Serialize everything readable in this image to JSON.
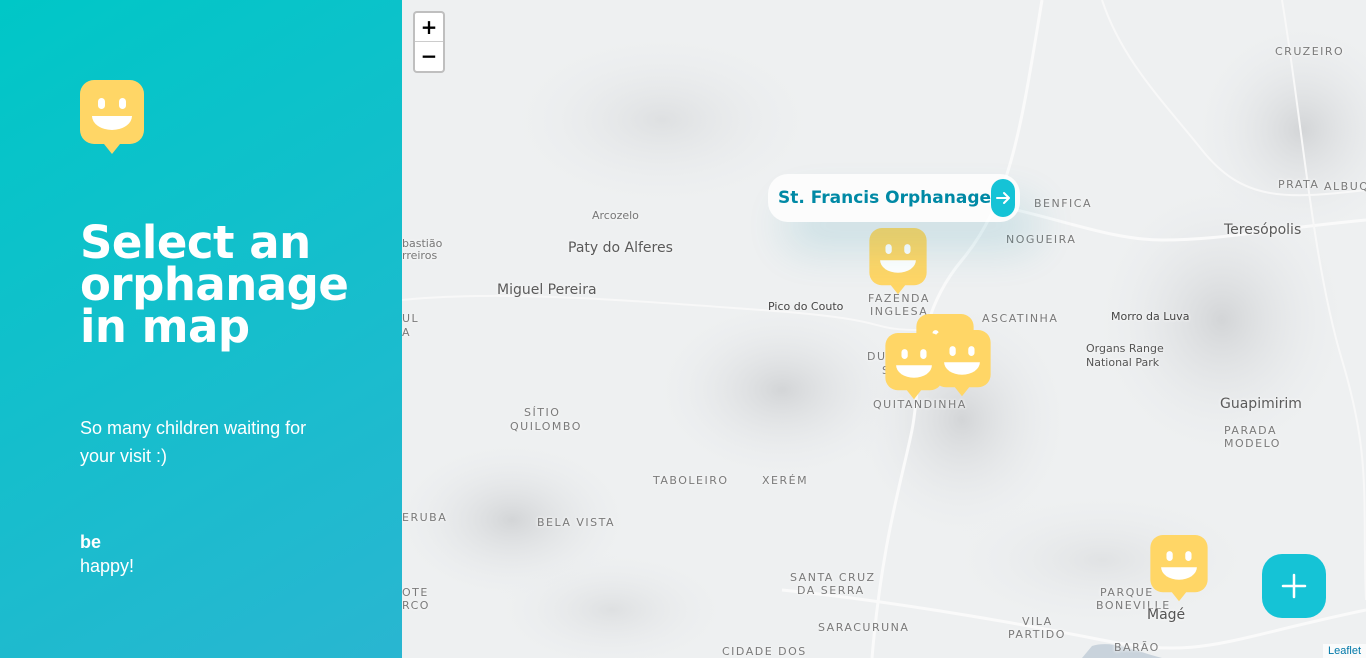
{
  "sidebar": {
    "logo_icon": "smiley-marker-icon",
    "title": "Select an orphanage in map",
    "subtitle": "So many children waiting for your visit :)",
    "footer_strong": "be",
    "footer_text": "happy!"
  },
  "colors": {
    "gradient_start": "#00C7C7",
    "gradient_end": "#29B6D1",
    "marker": "#FFD666",
    "accent": "#15C3D6",
    "popup_text": "#0089A5"
  },
  "map": {
    "zoom_in": "+",
    "zoom_out": "−",
    "attribution": "Leaflet",
    "places": {
      "cruzeiro": "CRUZEIRO",
      "prata": "PRATA",
      "albuq": "ALBUQ",
      "benfica": "BENFICA",
      "nogueira": "NOGUEIRA",
      "teresopolis": "Teresópolis",
      "arcozelo": "Arcozelo",
      "paty": "Paty do Alferes",
      "bastiao": "bastião",
      "rreiros": "rreiros",
      "miguel": "Miguel Pereira",
      "pico": "Pico do Couto",
      "fazenda": "FAZENDA",
      "inglesa": "INGLESA",
      "cascatinha": "ASCATINHA",
      "morro": "Morro da Luva",
      "organs1": "Organs Range",
      "organs2": "National Park",
      "ul": "UL",
      "a": "A",
      "sitio": "SÍTIO",
      "quilombo": "QUILOMBO",
      "du": "DU",
      "s": "S",
      "quitandinha": "QUITANDINHA",
      "guapimirim": "Guapimirim",
      "parada": "PARADA",
      "modelo": "MODELO",
      "taboleiro": "TABOLEIRO",
      "xerem": "XERÉM",
      "eruba": "ERUBA",
      "bela": "BELA VISTA",
      "santacruz": "SANTA CRUZ",
      "daserra": "DA SERRA",
      "parque": "PARQUE",
      "boneville": "BONEVILLE",
      "mage": "Magé",
      "ote": "OTE",
      "rco": "RCO",
      "saracuruna": "SARACURUNA",
      "vila": "VILA",
      "partido": "PARTIDO",
      "barao": "BARÃO",
      "cidade": "CIDADE DOS"
    },
    "popup": {
      "name": "St. Francis Orphanage",
      "link_icon": "arrow-right-icon"
    },
    "create_button_icon": "plus-icon"
  }
}
